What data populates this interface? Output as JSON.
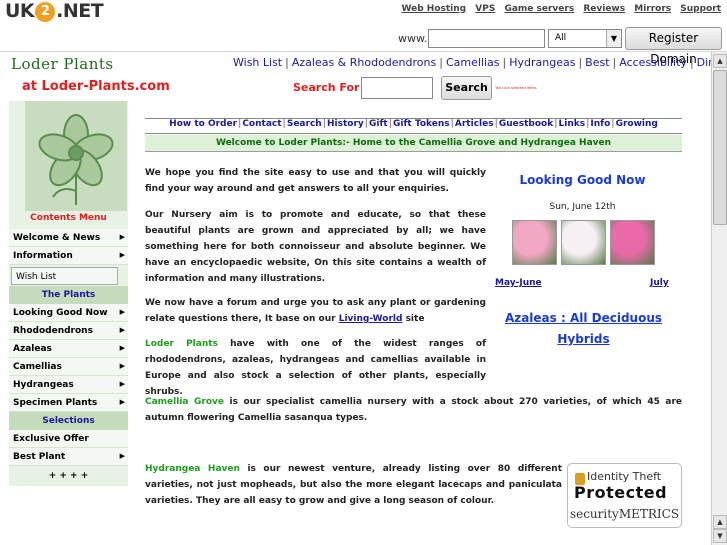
{
  "hostbar": {
    "logo_left": "UK",
    "logo_mid": "2",
    "logo_right": ".NET",
    "links": [
      "Web Hosting",
      "VPS",
      "Game servers",
      "Reviews",
      "Mirrors",
      "Support"
    ],
    "www_label": "www.",
    "domain_value": "",
    "tld_selected": "All",
    "register_label": "Register Domain"
  },
  "site": {
    "title": "Loder Plants",
    "url_text": "at Loder-Plants.com",
    "top_nav": [
      "Wish List",
      "Azaleas & Rhododendrons",
      "Camellias",
      "Hydrangeas",
      "Best",
      "Accessibility",
      "Directions"
    ],
    "search_label": "Search For :",
    "search_value": "",
    "search_button": "Search",
    "search_hint": "Tab click selected items"
  },
  "sidebar": {
    "contents_title": "Contents Menu",
    "items_top": [
      {
        "label": "Welcome & News",
        "arrow": "▶"
      },
      {
        "label": "Information",
        "arrow": "▶"
      }
    ],
    "wish_list": "Wish List",
    "plants_head": "The Plants",
    "plant_items": [
      {
        "label": "Looking Good Now",
        "arrow": "▶"
      },
      {
        "label": "Rhododendrons",
        "arrow": "▶"
      },
      {
        "label": "Azaleas",
        "arrow": "▶"
      },
      {
        "label": "Camellias",
        "arrow": "▶"
      },
      {
        "label": "Hydrangeas",
        "arrow": "▶"
      },
      {
        "label": "Specimen Plants",
        "arrow": "▶"
      }
    ],
    "selections_head": "Selections",
    "selection_items": [
      {
        "label": "Exclusive Offer",
        "arrow": ""
      },
      {
        "label": "Best Plant",
        "arrow": "▶"
      }
    ],
    "more": "+ + + +"
  },
  "content_nav": [
    "How to Order",
    "Contact",
    "Search",
    "History",
    "Gift",
    "Gift Tokens",
    "Articles",
    "Guestbook",
    "Links",
    "Info",
    "Growing"
  ],
  "welcome": "Welcome to Loder Plants:- Home to the Camellia Grove and Hydrangea Haven",
  "paragraphs": {
    "p1": "We hope you find the site easy to use and that you will quickly find your way around and get answers to all your enquiries.",
    "p2": "Our Nursery aim is to promote and educate, so that these beautiful plants are grown and appreciated by all; we have something here for both connoisseur and absolute beginner. We have an encyclopaedic website, On this site contains a wealth of information and many illustrations.",
    "p3_pre": "We now have a forum and urge you to ask any plant or gardening relate questions there, It base on our ",
    "p3_link": "Living-World",
    "p3_post": " site",
    "p4_name": "Loder Plants",
    "p4_text": " have with one of the widest ranges of rhododendrons, azaleas, hydrangeas and camellias available in Europe and also stock a selection of other plants, especially shrubs.",
    "p5_name": "Camellia Grove",
    "p5_text": " is our specialist camellia nursery with a stock about 270 varieties, of which 45 are autumn flowering Camellia sasanqua types.",
    "p6_name": "Hydrangea Haven",
    "p6_text": " is our newest venture, already listing over 80 different varieties, not just mopheads, but also the more elegant lacecaps and paniculata varieties. They are all easy to grow and give a long season of colour."
  },
  "feature": {
    "title": "Looking Good Now",
    "date": "Sun, June 12th",
    "prev_month": "May-June",
    "next_month": "July",
    "azaleas_link": "Azaleas : All Deciduous Hybrids",
    "flower_colors": [
      "#f2a8c4",
      "#f6f0f4",
      "#e86aa8"
    ]
  },
  "badge": {
    "line1": "Identity Theft",
    "line2": "Protected",
    "line3": "securityMETRICS"
  },
  "scrollbar": {
    "up": "▲",
    "down": "▼"
  },
  "colors": {
    "brand_green": "#1b6e1b",
    "accent_red": "#e02020",
    "link_blue": "#1a1a9a",
    "sidebar_bg": "#e8f2e4"
  }
}
